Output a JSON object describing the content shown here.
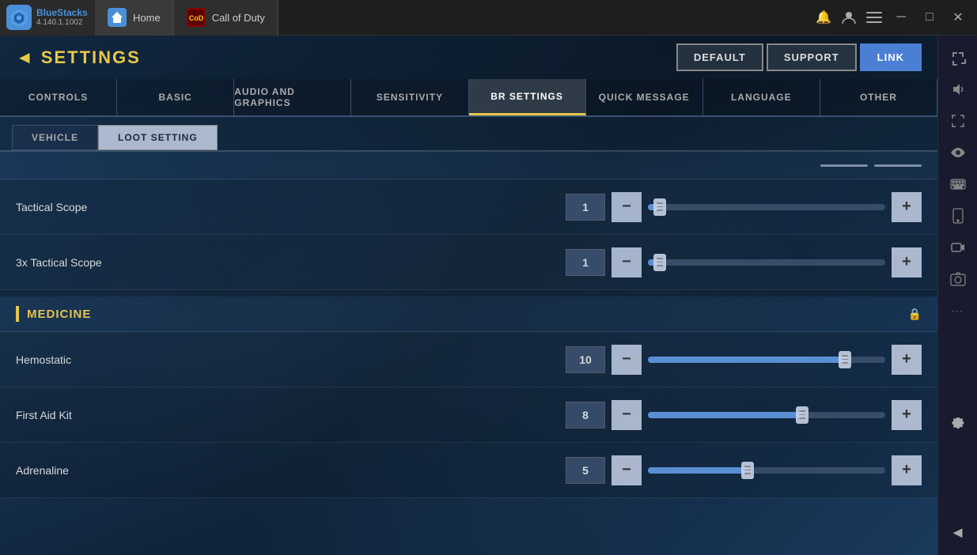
{
  "app": {
    "name": "BlueStacks",
    "version": "4.140.1.1002",
    "logo_text": "BS"
  },
  "titlebar": {
    "tabs": [
      {
        "id": "home",
        "label": "Home",
        "active": true
      },
      {
        "id": "cod",
        "label": "Call of Duty",
        "active": false
      }
    ],
    "controls": {
      "minimize": "─",
      "maximize": "□",
      "close": "✕"
    }
  },
  "header": {
    "back_arrow": "◄",
    "title": "SETTINGS",
    "buttons": [
      {
        "id": "default",
        "label": "DEFAULT",
        "active": false
      },
      {
        "id": "support",
        "label": "SUPPORT",
        "active": false
      },
      {
        "id": "link",
        "label": "LINK",
        "active": true
      }
    ]
  },
  "nav_tabs": [
    {
      "id": "controls",
      "label": "CONTROLS",
      "active": false
    },
    {
      "id": "basic",
      "label": "BASIC",
      "active": false
    },
    {
      "id": "audio_graphics",
      "label": "AUDIO AND GRAPHICS",
      "active": false
    },
    {
      "id": "sensitivity",
      "label": "SENSITIVITY",
      "active": false
    },
    {
      "id": "br_settings",
      "label": "BR SETTINGS",
      "active": true
    },
    {
      "id": "quick_message",
      "label": "QUICK MESSAGE",
      "active": false
    },
    {
      "id": "language",
      "label": "LANGUAGE",
      "active": false
    },
    {
      "id": "other",
      "label": "OTHER",
      "active": false
    }
  ],
  "sub_tabs": [
    {
      "id": "vehicle",
      "label": "VEHICLE",
      "active": false
    },
    {
      "id": "loot_setting",
      "label": "LOOT SETTING",
      "active": true
    }
  ],
  "settings": {
    "sections": [
      {
        "id": "optics",
        "items": [
          {
            "id": "tactical_scope",
            "name": "Tactical Scope",
            "value": "1",
            "fill_pct": 5,
            "thumb_pct": 5
          },
          {
            "id": "3x_tactical_scope",
            "name": "3x Tactical Scope",
            "value": "1",
            "fill_pct": 5,
            "thumb_pct": 5
          }
        ]
      },
      {
        "id": "medicine",
        "title": "Medicine",
        "items": [
          {
            "id": "hemostatic",
            "name": "Hemostatic",
            "value": "10",
            "fill_pct": 83,
            "thumb_pct": 83
          },
          {
            "id": "first_aid_kit",
            "name": "First Aid Kit",
            "value": "8",
            "fill_pct": 65,
            "thumb_pct": 65
          },
          {
            "id": "adrenaline",
            "name": "Adrenaline",
            "value": "5",
            "fill_pct": 42,
            "thumb_pct": 42
          }
        ]
      }
    ]
  },
  "sidebar_icons": {
    "expand": "⤢",
    "volume": "🔊",
    "fullscreen": "⤡",
    "eye": "◉",
    "keyboard": "⌨",
    "phone": "📱",
    "camera_record": "⊕",
    "screenshot": "📷",
    "dots": "···",
    "gear": "⚙",
    "back": "◄"
  }
}
